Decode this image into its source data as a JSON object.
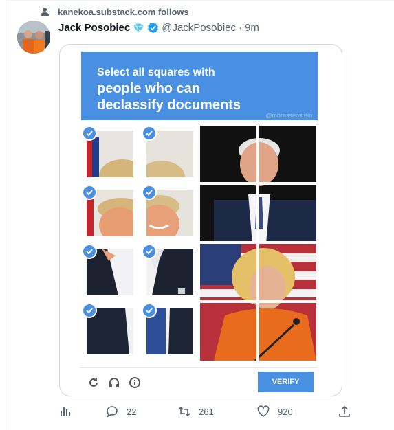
{
  "context": {
    "text": "kanekoa.substack.com follows",
    "icon": "person-icon"
  },
  "author": {
    "name": "Jack Posobiec",
    "handle": "@JackPosobiec",
    "separator": "·",
    "time": "9m"
  },
  "captcha": {
    "line1": "Select all squares with",
    "line2": "people who can",
    "line3": "declassify documents",
    "watermark": "@mbrassenstein",
    "verify_label": "VERIFY",
    "selected_tiles": 8,
    "accent": "#4a90e2"
  },
  "actions": {
    "replies": "22",
    "retweets": "261",
    "likes": "920"
  }
}
